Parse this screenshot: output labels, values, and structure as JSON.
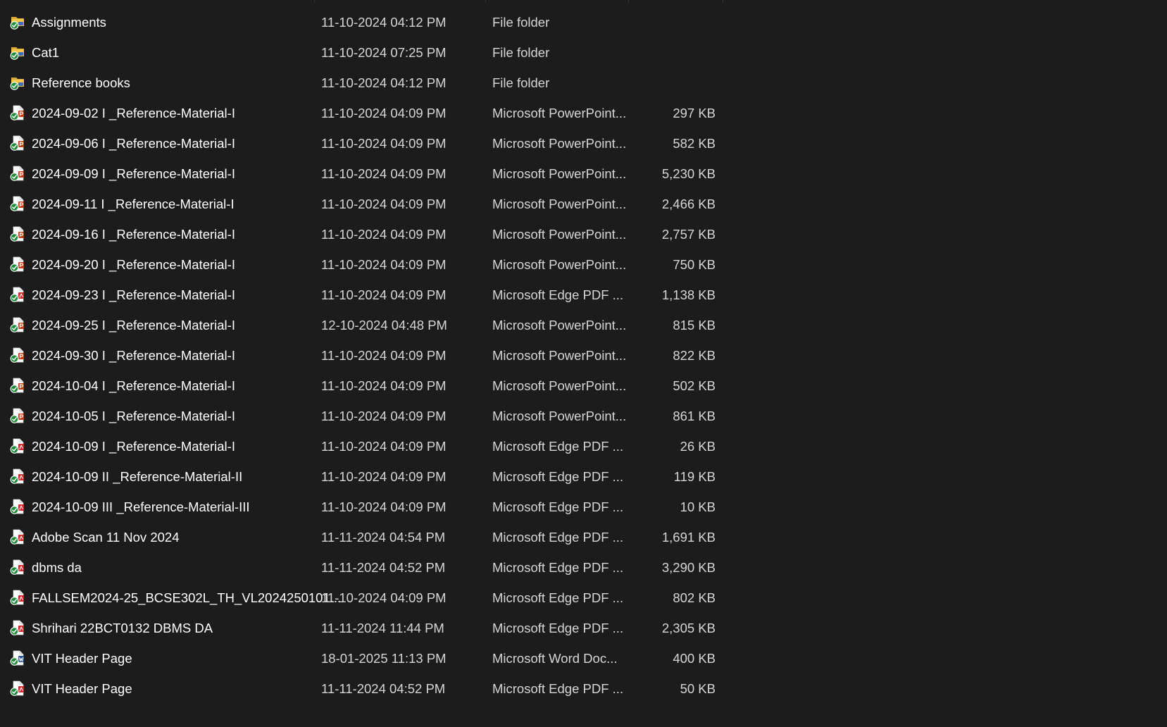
{
  "colors": {
    "background": "#1c1c1c",
    "text_primary": "#ffffff",
    "text_secondary": "#d6d6d6",
    "sync_green": "#1e8a3a",
    "folder_yellow": "#f3c84b",
    "ppt_red": "#c43e1c",
    "pdf_red": "#d6272e",
    "word_blue": "#2b579a"
  },
  "files": [
    {
      "name": "Assignments",
      "modified": "11-10-2024 04:12 PM",
      "type": "File folder",
      "size": "",
      "icon": "folder-icon"
    },
    {
      "name": "Cat1",
      "modified": "11-10-2024 07:25 PM",
      "type": "File folder",
      "size": "",
      "icon": "folder-icon"
    },
    {
      "name": "Reference books",
      "modified": "11-10-2024 04:12 PM",
      "type": "File folder",
      "size": "",
      "icon": "folder-icon"
    },
    {
      "name": "2024-09-02     I     _Reference-Material-I",
      "modified": "11-10-2024 04:09 PM",
      "type": "Microsoft PowerPoint...",
      "size": "297 KB",
      "icon": "powerpoint-icon"
    },
    {
      "name": "2024-09-06     I     _Reference-Material-I",
      "modified": "11-10-2024 04:09 PM",
      "type": "Microsoft PowerPoint...",
      "size": "582 KB",
      "icon": "powerpoint-icon"
    },
    {
      "name": "2024-09-09     I     _Reference-Material-I",
      "modified": "11-10-2024 04:09 PM",
      "type": "Microsoft PowerPoint...",
      "size": "5,230 KB",
      "icon": "powerpoint-icon"
    },
    {
      "name": "2024-09-11     I     _Reference-Material-I",
      "modified": "11-10-2024 04:09 PM",
      "type": "Microsoft PowerPoint...",
      "size": "2,466 KB",
      "icon": "powerpoint-icon"
    },
    {
      "name": "2024-09-16     I     _Reference-Material-I",
      "modified": "11-10-2024 04:09 PM",
      "type": "Microsoft PowerPoint...",
      "size": "2,757 KB",
      "icon": "powerpoint-icon"
    },
    {
      "name": "2024-09-20     I     _Reference-Material-I",
      "modified": "11-10-2024 04:09 PM",
      "type": "Microsoft PowerPoint...",
      "size": "750 KB",
      "icon": "powerpoint-icon"
    },
    {
      "name": "2024-09-23     I     _Reference-Material-I",
      "modified": "11-10-2024 04:09 PM",
      "type": "Microsoft Edge PDF ...",
      "size": "1,138 KB",
      "icon": "pdf-icon"
    },
    {
      "name": "2024-09-25     I     _Reference-Material-I",
      "modified": "12-10-2024 04:48 PM",
      "type": "Microsoft PowerPoint...",
      "size": "815 KB",
      "icon": "powerpoint-icon"
    },
    {
      "name": "2024-09-30     I     _Reference-Material-I",
      "modified": "11-10-2024 04:09 PM",
      "type": "Microsoft PowerPoint...",
      "size": "822 KB",
      "icon": "powerpoint-icon"
    },
    {
      "name": "2024-10-04     I     _Reference-Material-I",
      "modified": "11-10-2024 04:09 PM",
      "type": "Microsoft PowerPoint...",
      "size": "502 KB",
      "icon": "powerpoint-icon"
    },
    {
      "name": "2024-10-05     I     _Reference-Material-I",
      "modified": "11-10-2024 04:09 PM",
      "type": "Microsoft PowerPoint...",
      "size": "861 KB",
      "icon": "powerpoint-icon"
    },
    {
      "name": "2024-10-09     I     _Reference-Material-I",
      "modified": "11-10-2024 04:09 PM",
      "type": "Microsoft Edge PDF ...",
      "size": "26 KB",
      "icon": "pdf-icon"
    },
    {
      "name": "2024-10-09     II     _Reference-Material-II",
      "modified": "11-10-2024 04:09 PM",
      "type": "Microsoft Edge PDF ...",
      "size": "119 KB",
      "icon": "pdf-icon"
    },
    {
      "name": "2024-10-09     III     _Reference-Material-III",
      "modified": "11-10-2024 04:09 PM",
      "type": "Microsoft Edge PDF ...",
      "size": "10 KB",
      "icon": "pdf-icon"
    },
    {
      "name": "Adobe Scan 11 Nov 2024",
      "modified": "11-11-2024 04:54 PM",
      "type": "Microsoft Edge PDF ...",
      "size": "1,691 KB",
      "icon": "pdf-icon"
    },
    {
      "name": "dbms da",
      "modified": "11-11-2024 04:52 PM",
      "type": "Microsoft Edge PDF ...",
      "size": "3,290 KB",
      "icon": "pdf-icon"
    },
    {
      "name": "FALLSEM2024-25_BCSE302L_TH_VL2024250101...",
      "modified": "11-10-2024 04:09 PM",
      "type": "Microsoft Edge PDF ...",
      "size": "802 KB",
      "icon": "pdf-icon"
    },
    {
      "name": "Shrihari 22BCT0132 DBMS DA",
      "modified": "11-11-2024 11:44 PM",
      "type": "Microsoft Edge PDF ...",
      "size": "2,305 KB",
      "icon": "pdf-icon"
    },
    {
      "name": "VIT Header Page",
      "modified": "18-01-2025 11:13 PM",
      "type": "Microsoft Word Doc...",
      "size": "400 KB",
      "icon": "word-icon"
    },
    {
      "name": "VIT Header Page",
      "modified": "11-11-2024 04:52 PM",
      "type": "Microsoft Edge PDF ...",
      "size": "50 KB",
      "icon": "pdf-icon"
    }
  ]
}
